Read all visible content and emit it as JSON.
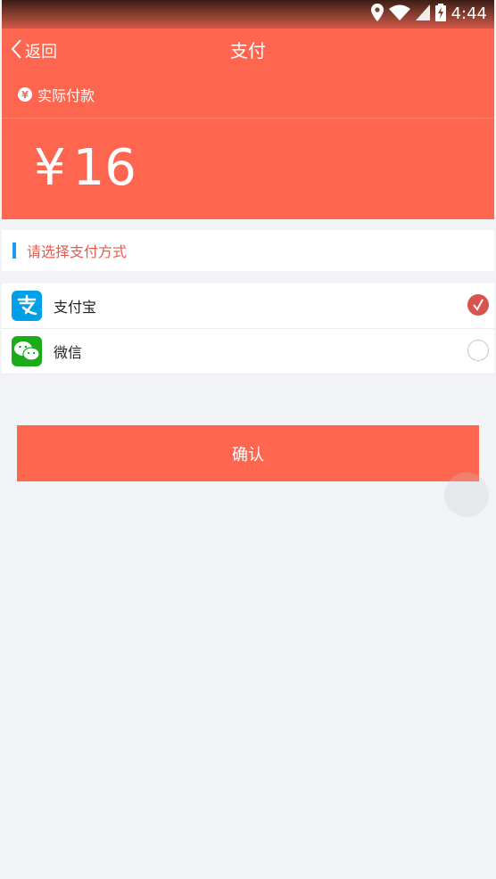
{
  "status_bar": {
    "time": "4:44"
  },
  "header": {
    "back_label": "返回",
    "title": "支付",
    "paid_label": "实际付款",
    "currency_symbol": "¥",
    "amount": "16"
  },
  "section": {
    "label": "请选择支付方式"
  },
  "payment_methods": [
    {
      "label": "支付宝",
      "icon": "alipay-icon",
      "selected": true
    },
    {
      "label": "微信",
      "icon": "wechat-icon",
      "selected": false
    }
  ],
  "confirm_label": "确认",
  "colors": {
    "primary": "#ff6650",
    "accent_blue": "#1e9be8",
    "section_text": "#e85a4f",
    "check_red": "#d9534f",
    "wechat_green": "#1aad19",
    "alipay_blue": "#00a0e9"
  }
}
